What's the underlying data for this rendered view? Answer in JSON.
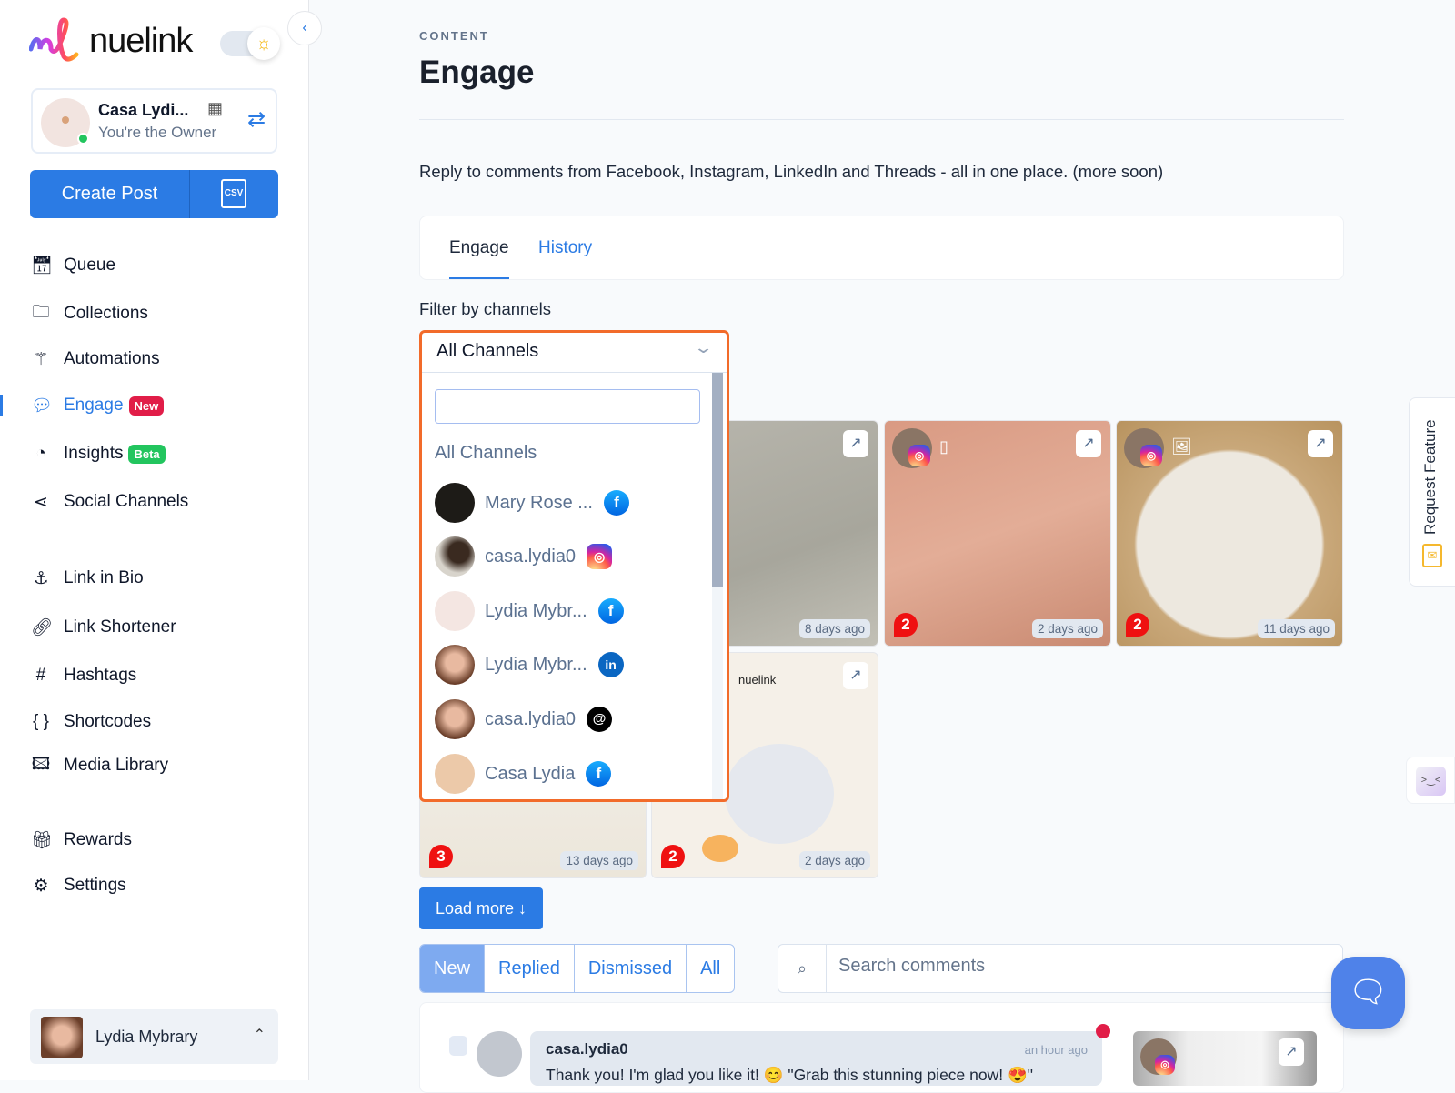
{
  "brand": {
    "name": "nuelink"
  },
  "account": {
    "name": "Casa Lydi...",
    "role": "You're the Owner"
  },
  "create_post": {
    "label": "Create Post",
    "csv_label": "CSV"
  },
  "sidebar": {
    "items": [
      {
        "label": "Queue",
        "icon": "calendar-icon"
      },
      {
        "label": "Collections",
        "icon": "folder-icon"
      },
      {
        "label": "Automations",
        "icon": "magic-wand-icon"
      },
      {
        "label": "Engage",
        "icon": "chat-icon",
        "badge": "New",
        "active": true
      },
      {
        "label": "Insights",
        "icon": "pie-chart-icon",
        "badge": "Beta"
      },
      {
        "label": "Social Channels",
        "icon": "share-icon"
      },
      {
        "label": "Link in Bio",
        "icon": "anchor-icon"
      },
      {
        "label": "Link Shortener",
        "icon": "link-icon"
      },
      {
        "label": "Hashtags",
        "icon": "hash-icon"
      },
      {
        "label": "Shortcodes",
        "icon": "braces-icon"
      },
      {
        "label": "Media Library",
        "icon": "images-icon"
      },
      {
        "label": "Rewards",
        "icon": "gift-icon"
      },
      {
        "label": "Settings",
        "icon": "gear-icon"
      }
    ]
  },
  "user": {
    "name": "Lydia Mybrary"
  },
  "page": {
    "kicker": "CONTENT",
    "title": "Engage",
    "description": "Reply to comments from Facebook, Instagram, LinkedIn and Threads - all in one place. (more soon)"
  },
  "tabs": [
    {
      "label": "Engage",
      "active": true
    },
    {
      "label": "History"
    }
  ],
  "filter": {
    "label": "Filter by channels",
    "selected": "All Channels",
    "search_value": "",
    "all_option": "All Channels",
    "options": [
      {
        "name": "Mary Rose ...",
        "network": "facebook"
      },
      {
        "name": "casa.lydia0",
        "network": "instagram"
      },
      {
        "name": "Lydia Mybr...",
        "network": "facebook"
      },
      {
        "name": "Lydia Mybr...",
        "network": "linkedin"
      },
      {
        "name": "casa.lydia0",
        "network": "threads"
      },
      {
        "name": "Casa Lydia",
        "network": "facebook"
      }
    ]
  },
  "posts": [
    {
      "ago": "8 days ago"
    },
    {
      "ago": "2 days ago",
      "comments": "2",
      "network": "instagram",
      "type": "carousel"
    },
    {
      "ago": "11 days ago",
      "comments": "2",
      "network": "instagram",
      "type": "image"
    },
    {
      "ago": "13 days ago",
      "comments": "3"
    },
    {
      "ago": "2 days ago",
      "comments": "2",
      "logo_text": "nuelink"
    }
  ],
  "load_more": "Load more",
  "status_filters": [
    {
      "label": "New",
      "active": true
    },
    {
      "label": "Replied"
    },
    {
      "label": "Dismissed"
    },
    {
      "label": "All"
    }
  ],
  "search": {
    "placeholder": "Search comments",
    "value": ""
  },
  "comment": {
    "user": "casa.lydia0",
    "time": "an hour ago",
    "text": "Thank you! I'm glad you like it! 😊 \"Grab this stunning piece now! 😍\""
  },
  "request_feature": "Request Feature",
  "colors": {
    "primary": "#2b7be4",
    "new_badge": "#e11d48",
    "beta_badge": "#22c55e",
    "dropdown_focus": "#f26b2a"
  }
}
